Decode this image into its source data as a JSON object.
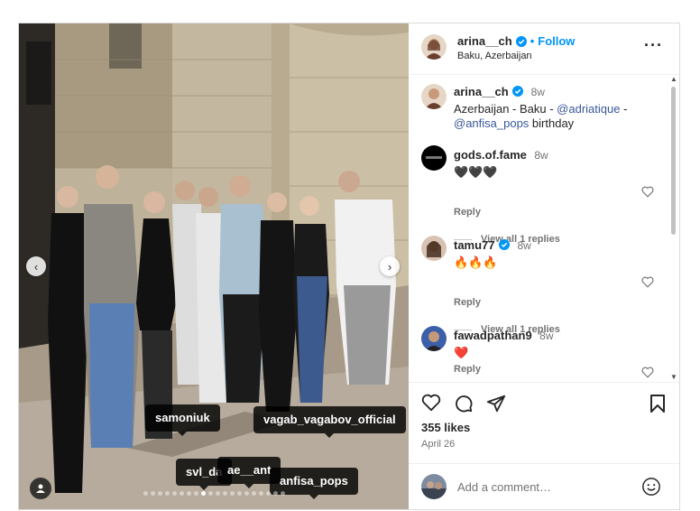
{
  "header": {
    "username": "arina__ch",
    "follow_label": "Follow",
    "separator": "•",
    "location": "Baku, Azerbaijan"
  },
  "caption": {
    "username": "arina__ch",
    "time": "8w",
    "text_1": "Azerbaijan - Baku - ",
    "mention_1": "@adriatique",
    "text_2": " - ",
    "mention_2": "@anfisa_pops",
    "text_3": " birthday"
  },
  "comments": [
    {
      "username": "gods.of.fame",
      "time": "8w",
      "text": "🖤🖤🖤",
      "reply_label": "Reply",
      "view_replies": "View all 1 replies"
    },
    {
      "username": "tamu77",
      "time": "8w",
      "text": "🔥🔥🔥",
      "reply_label": "Reply",
      "view_replies": "View all 1 replies"
    },
    {
      "username": "fawadpathan9",
      "time": "8w",
      "text": "❤️",
      "reply_label": "Reply"
    }
  ],
  "photo_tags": [
    "samoniuk",
    "vagab_vagabov_official",
    "svl_da",
    "ae__ant",
    "anfisa_pops"
  ],
  "carousel": {
    "total": 20,
    "active": 8
  },
  "likes": "355 likes",
  "date": "April 26",
  "add_comment_placeholder": "Add a comment…",
  "colors": {
    "accent": "#0095f6",
    "verified": "#0095f6",
    "mention": "#385898"
  }
}
